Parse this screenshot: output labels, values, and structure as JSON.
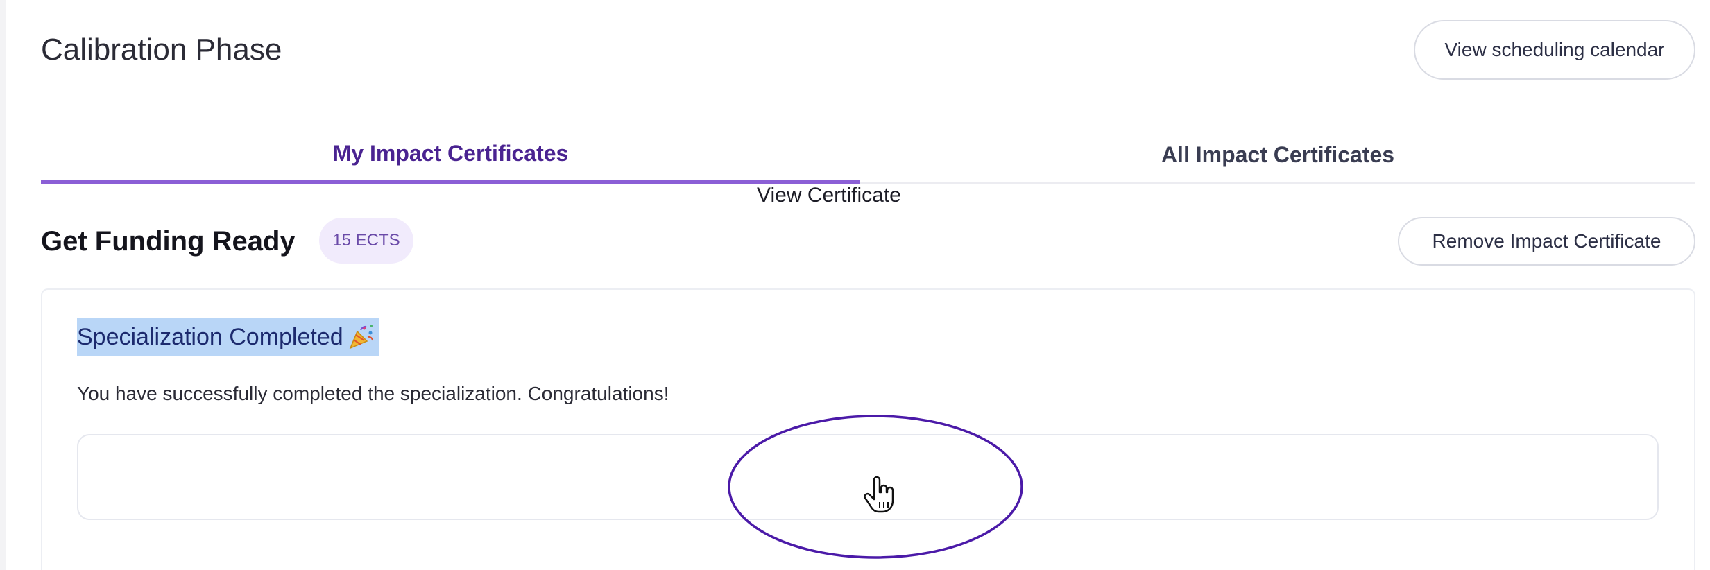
{
  "header": {
    "title": "Calibration Phase",
    "schedule_button": "View scheduling calendar"
  },
  "tabs": [
    {
      "label": "My Impact Certificates",
      "active": true
    },
    {
      "label": "All Impact Certificates",
      "active": false
    }
  ],
  "section": {
    "title": "Get Funding Ready",
    "badge": "15 ECTS",
    "remove_button": "Remove Impact Certificate"
  },
  "card": {
    "title": "Specialization Completed",
    "title_icon": "party-popper-icon",
    "message": "You have successfully completed the specialization. Congratulations!",
    "view_button": "View Certificate"
  },
  "colors": {
    "accent": "#4a2391",
    "tab_underline": "#8b5fd6",
    "badge_bg": "#f1ebfc",
    "selection": "#b9d6f7",
    "annotation": "#4b1aa8"
  }
}
